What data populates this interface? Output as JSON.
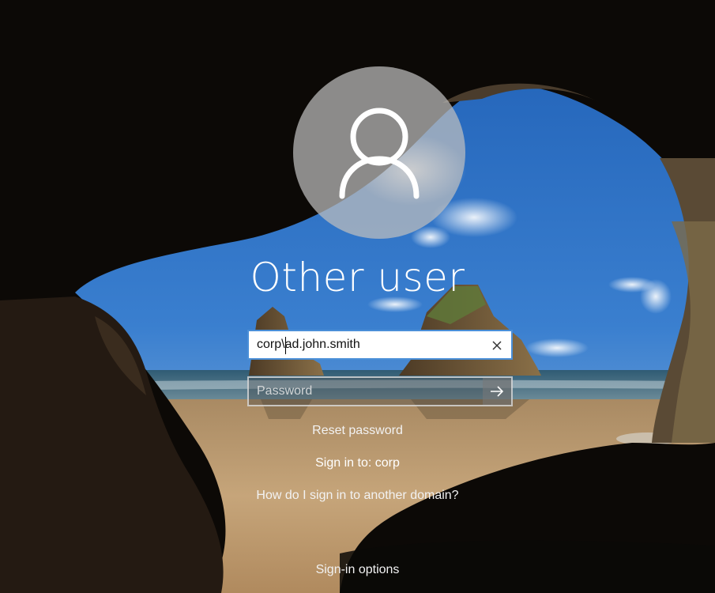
{
  "login": {
    "user_title": "Other user",
    "username_value": "corp\\ad.john.smith",
    "password_placeholder": "Password",
    "reset_password": "Reset password",
    "sign_in_to": "Sign in to: corp",
    "another_domain": "How do I sign in to another domain?",
    "sign_in_options": "Sign-in options"
  },
  "icons": {
    "avatar": "user-icon",
    "clear": "close-icon",
    "submit": "arrow-right-icon"
  },
  "colors": {
    "focus_border": "#4a8fd8",
    "text": "#ffffff"
  }
}
